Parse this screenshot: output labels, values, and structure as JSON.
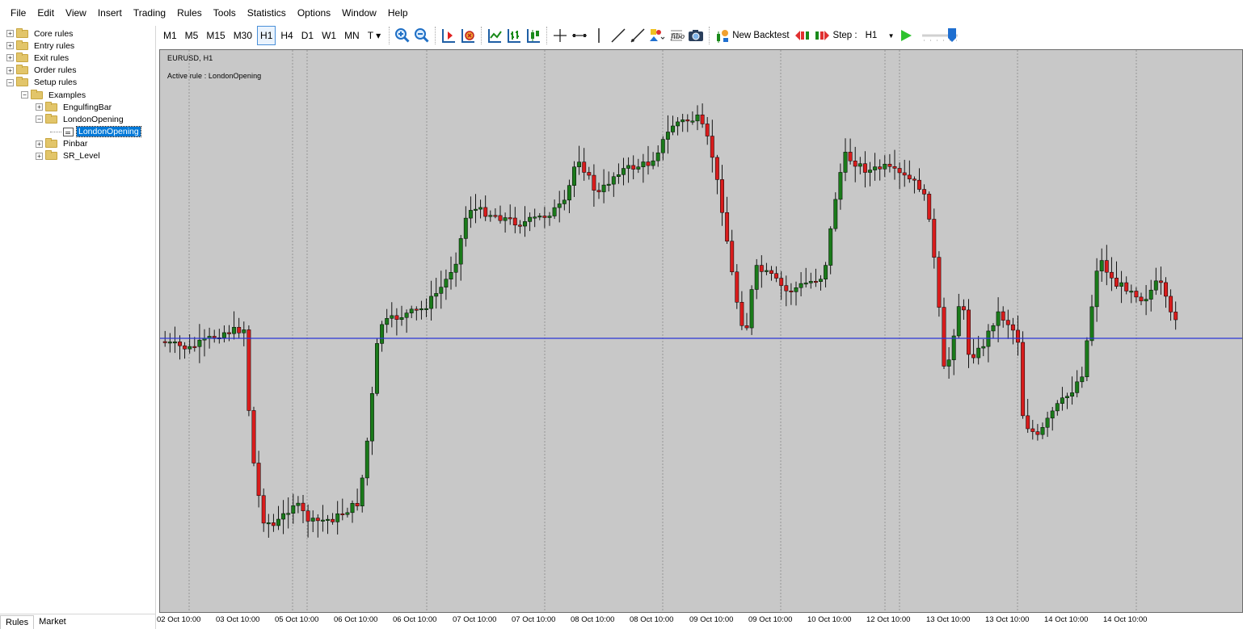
{
  "menu": [
    "File",
    "Edit",
    "View",
    "Insert",
    "Trading",
    "Rules",
    "Tools",
    "Statistics",
    "Options",
    "Window",
    "Help"
  ],
  "tree": [
    {
      "label": "Core rules",
      "level": 0,
      "expander": "+",
      "kind": "folder"
    },
    {
      "label": "Entry rules",
      "level": 0,
      "expander": "+",
      "kind": "folder"
    },
    {
      "label": "Exit rules",
      "level": 0,
      "expander": "+",
      "kind": "folder"
    },
    {
      "label": "Order rules",
      "level": 0,
      "expander": "+",
      "kind": "folder"
    },
    {
      "label": "Setup rules",
      "level": 0,
      "expander": "−",
      "kind": "folder"
    },
    {
      "label": "Examples",
      "level": 1,
      "expander": "−",
      "kind": "folder"
    },
    {
      "label": "EngulfingBar",
      "level": 2,
      "expander": "+",
      "kind": "folder"
    },
    {
      "label": "LondonOpening",
      "level": 2,
      "expander": "−",
      "kind": "folder"
    },
    {
      "label": "LondonOpening",
      "level": 3,
      "expander": "",
      "kind": "doc",
      "selected": true
    },
    {
      "label": "Pinbar",
      "level": 2,
      "expander": "+",
      "kind": "folder"
    },
    {
      "label": "SR_Level",
      "level": 2,
      "expander": "+",
      "kind": "folder"
    }
  ],
  "bottom_tabs": [
    "Rules",
    "Market"
  ],
  "timeframes": [
    {
      "label": "M1"
    },
    {
      "label": "M5"
    },
    {
      "label": "M15"
    },
    {
      "label": "M30"
    },
    {
      "label": "H1",
      "active": true
    },
    {
      "label": "H4"
    },
    {
      "label": "D1"
    },
    {
      "label": "W1"
    },
    {
      "label": "MN"
    },
    {
      "label": "T ▾"
    }
  ],
  "toolbar": {
    "new_backtest": "New Backtest",
    "step_label": "Step :",
    "step_value": "H1"
  },
  "chart": {
    "symbol": "EURUSD, H1",
    "active_rule": "Active rule : LondonOpening",
    "colors": {
      "background": "#c8c8c8",
      "bull": "#1a7a1a",
      "bear": "#d81c1c",
      "wick": "#000000",
      "level_line": "#2b35d6",
      "grid": "#8a8a8a"
    },
    "time_labels": [
      "02 Oct 10:00",
      "03 Oct 10:00",
      "05 Oct 10:00",
      "06 Oct 10:00",
      "06 Oct 10:00",
      "07 Oct 10:00",
      "07 Oct 10:00",
      "08 Oct 10:00",
      "08 Oct 10:00",
      "09 Oct 10:00",
      "09 Oct 10:00",
      "10 Oct 10:00",
      "12 Oct 10:00",
      "13 Oct 10:00",
      "13 Oct 10:00",
      "14 Oct 10:00",
      "14 Oct 10:00"
    ]
  }
}
